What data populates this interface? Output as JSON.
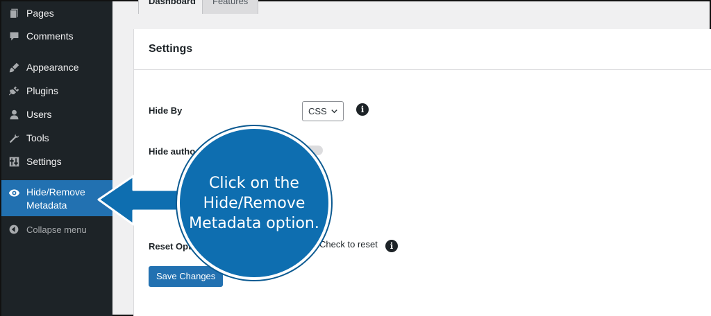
{
  "sidebar": {
    "items": [
      {
        "label": "Pages",
        "icon": "pages-icon"
      },
      {
        "label": "Comments",
        "icon": "comment-icon"
      },
      {
        "label": "Appearance",
        "icon": "brush-icon"
      },
      {
        "label": "Plugins",
        "icon": "plug-icon"
      },
      {
        "label": "Users",
        "icon": "user-icon"
      },
      {
        "label": "Tools",
        "icon": "wrench-icon"
      },
      {
        "label": "Settings",
        "icon": "sliders-icon"
      },
      {
        "label": "Hide/Remove Metadata",
        "icon": "eye-icon",
        "active": true
      },
      {
        "label": "Collapse menu",
        "icon": "collapse-icon"
      }
    ]
  },
  "tabs": [
    {
      "label": "Dashboard",
      "active": true
    },
    {
      "label": "Features",
      "active": false
    }
  ],
  "settings": {
    "title": "Settings",
    "hide_by_label": "Hide By",
    "hide_by_value": "CSS",
    "hide_author_label": "Hide autho",
    "reset_label": "Reset Optio",
    "reset_checkbox_label": "Check to reset",
    "save_label": "Save Changes"
  },
  "callout": {
    "text": "Click on the Hide/Remove Metadata option."
  },
  "colors": {
    "sidebar_bg": "#1d2327",
    "active_bg": "#2271b1",
    "callout_bg": "#0e6eb0",
    "button_bg": "#2271b1"
  }
}
